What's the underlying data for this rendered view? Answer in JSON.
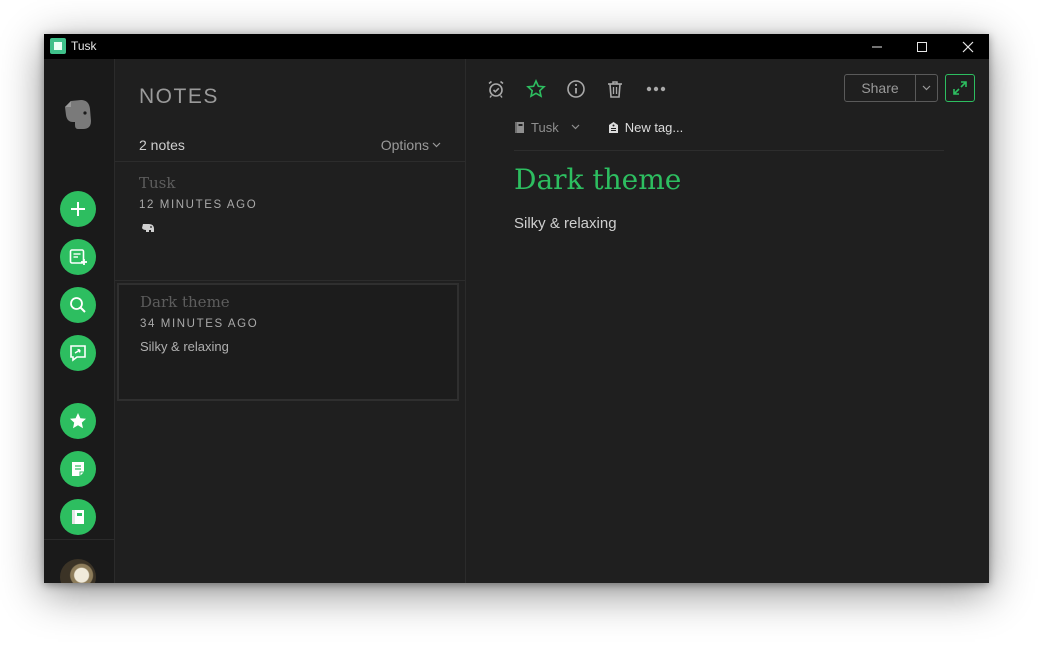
{
  "window": {
    "title": "Tusk"
  },
  "notes_panel": {
    "heading": "NOTES",
    "count": "2 notes",
    "options_label": "Options",
    "notes": [
      {
        "title": "Tusk",
        "time": "12 MINUTES AGO",
        "snippet": ""
      },
      {
        "title": "Dark theme",
        "time": "34 MINUTES AGO",
        "snippet": "Silky & relaxing"
      }
    ]
  },
  "editor": {
    "share_label": "Share",
    "notebook": "Tusk",
    "new_tag_placeholder": "New tag...",
    "note_title": "Dark theme",
    "note_body": "Silky & relaxing"
  },
  "colors": {
    "accent": "#2dbe60",
    "background": "#1f1f1f",
    "titlebar": "#000000"
  },
  "icons": {
    "sidebar": [
      "elephant-logo-icon",
      "new-note-icon",
      "new-chat-icon",
      "search-icon",
      "work-chat-icon",
      "shortcuts-icon",
      "notes-icon",
      "notebooks-icon"
    ],
    "toolbar": [
      "reminder-icon",
      "star-icon",
      "info-icon",
      "trash-icon",
      "more-icon",
      "expand-icon"
    ]
  }
}
